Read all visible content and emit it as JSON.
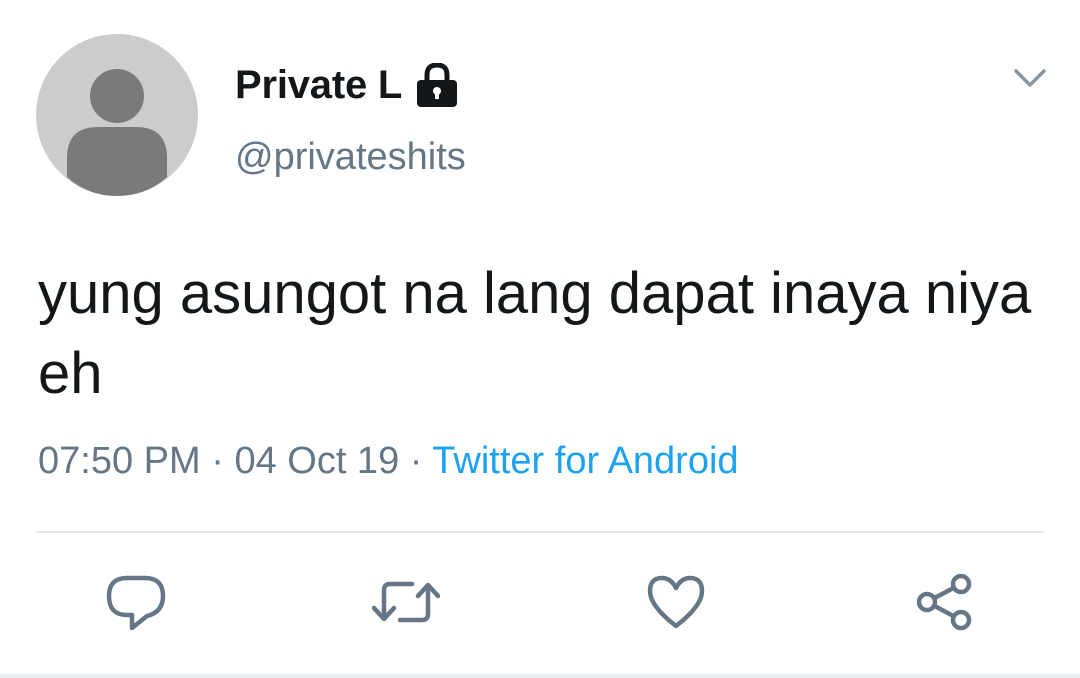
{
  "user": {
    "display_name": "Private L",
    "handle": "@privateshits",
    "protected_icon": "lock-icon",
    "avatar_icon": "default-avatar-icon"
  },
  "tweet": {
    "text": "yung asungot na lang dapat inaya niya eh",
    "time": "07:50 PM",
    "separator_1": " · ",
    "date": "04 Oct 19",
    "separator_2": " · ",
    "source": "Twitter for Android"
  },
  "actions": {
    "reply_icon": "reply-icon",
    "retweet_icon": "retweet-icon",
    "like_icon": "heart-icon",
    "share_icon": "share-icon",
    "menu_icon": "chevron-down-icon"
  },
  "colors": {
    "text_primary": "#14171a",
    "text_secondary": "#657786",
    "link": "#1da1f2",
    "icon": "#657786",
    "avatar_bg": "#cccccc",
    "avatar_fg": "#7a7a7a",
    "divider": "#e1e8ed"
  }
}
